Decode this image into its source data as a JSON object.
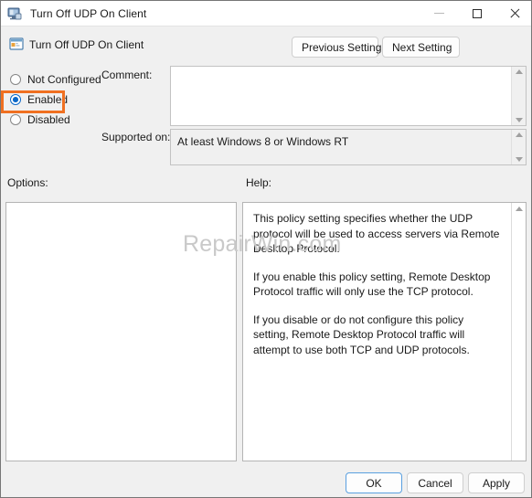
{
  "window": {
    "title": "Turn Off UDP On Client",
    "icon": "policy-monitor-icon"
  },
  "caption": {
    "minimize": "minimize-icon",
    "maximize": "maximize-icon",
    "close": "close-icon"
  },
  "header": {
    "icon": "policy-setting-icon",
    "title": "Turn Off UDP On Client",
    "previous_label": "Previous Setting",
    "next_label": "Next Setting"
  },
  "state": {
    "options": [
      {
        "id": "not-configured",
        "label": "Not Configured",
        "checked": false
      },
      {
        "id": "enabled",
        "label": "Enabled",
        "checked": true
      },
      {
        "id": "disabled",
        "label": "Disabled",
        "checked": false
      }
    ],
    "highlight_color": "#f07021",
    "accent_color": "#0a68c8"
  },
  "comment": {
    "label": "Comment:",
    "value": "",
    "placeholder": ""
  },
  "supported": {
    "label": "Supported on:",
    "value": "At least Windows 8 or Windows RT"
  },
  "options_panel": {
    "label": "Options:",
    "content": ""
  },
  "help_panel": {
    "label": "Help:",
    "paragraphs": [
      "This policy setting specifies whether the UDP protocol will be used to access servers via Remote Desktop Protocol.",
      "If you enable this policy setting, Remote Desktop Protocol traffic will only use the TCP protocol.",
      "If you disable or do not configure this policy setting, Remote Desktop Protocol traffic will attempt to use both TCP and UDP protocols."
    ]
  },
  "footer": {
    "ok_label": "OK",
    "cancel_label": "Cancel",
    "apply_label": "Apply"
  },
  "watermark": {
    "text": "RepairWin.com"
  }
}
